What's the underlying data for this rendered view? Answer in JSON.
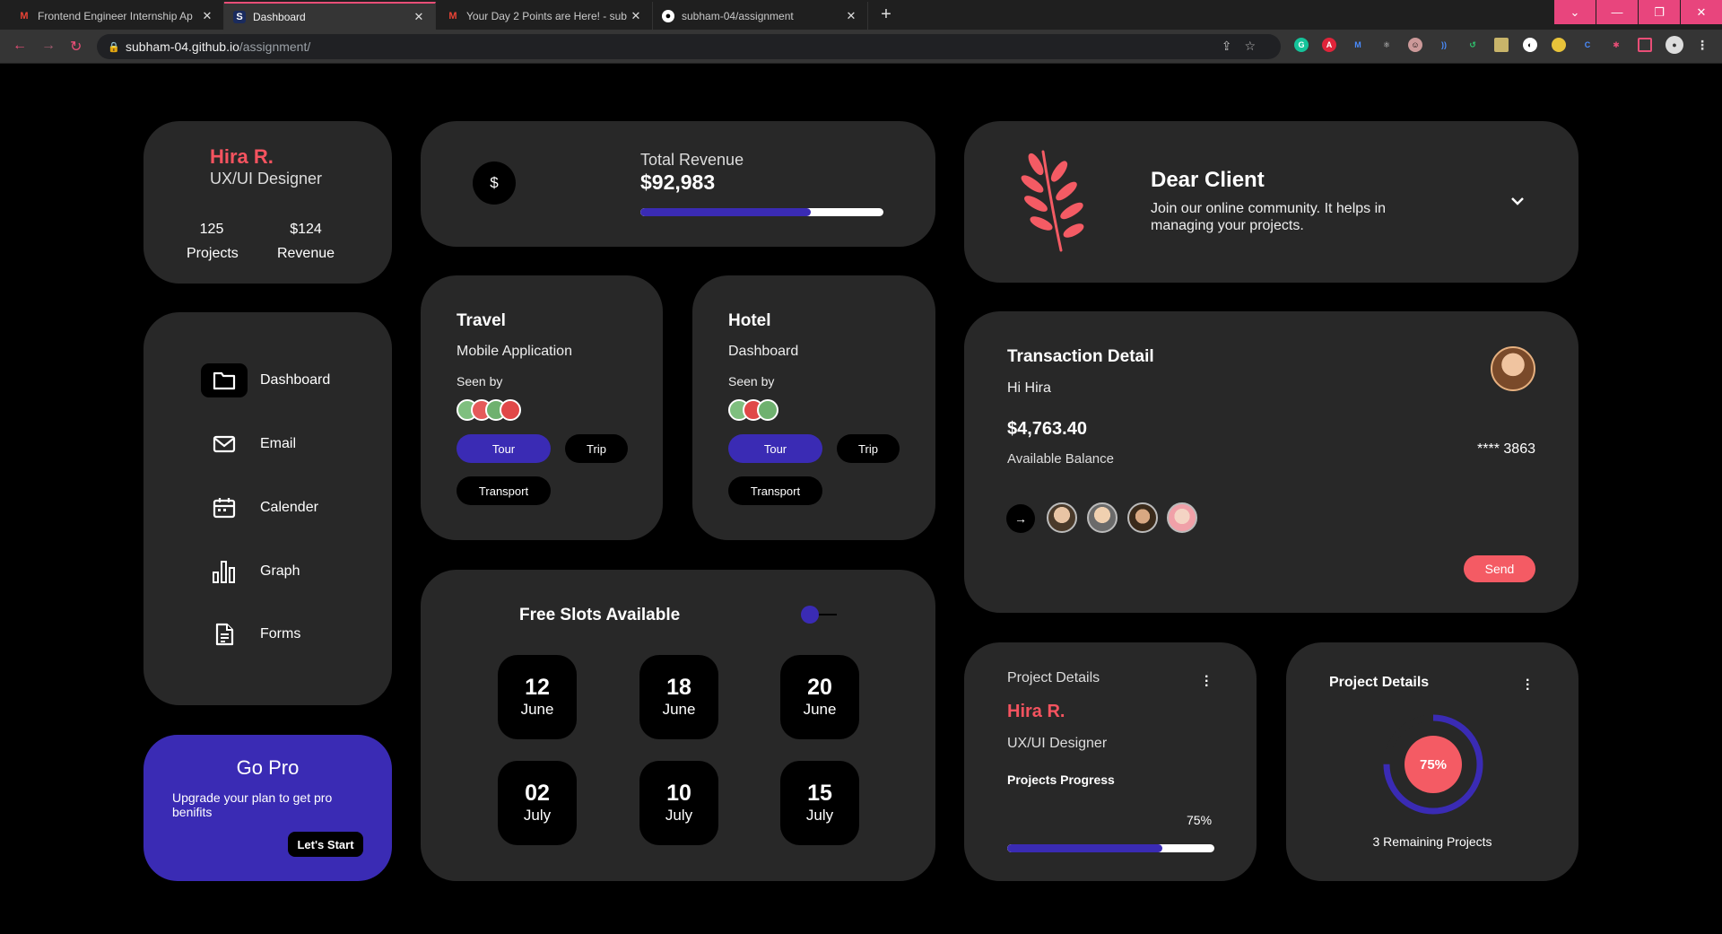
{
  "browser": {
    "tabs": [
      {
        "title": "Frontend Engineer Internship Ap",
        "icon": "gmail-icon"
      },
      {
        "title": "Dashboard",
        "icon": "site-icon",
        "active": true
      },
      {
        "title": "Your Day 2 Points are Here! - sub",
        "icon": "gmail-icon"
      },
      {
        "title": "subham-04/assignment",
        "icon": "github-icon"
      }
    ],
    "url_host": "subham-04.github.io",
    "url_path": "/assignment/",
    "accent": "#e94e77"
  },
  "profile": {
    "name": "Hira R.",
    "role": "UX/UI Designer",
    "projects_value": "125",
    "projects_label": "Projects",
    "revenue_value": "$124",
    "revenue_label": "Revenue"
  },
  "revenue": {
    "icon_text": "$",
    "label": "Total Revenue",
    "value": "$92,983",
    "progress": 0.7
  },
  "client": {
    "title": "Dear Client",
    "description": "Join our online community. It helps in managing your projects."
  },
  "sidebar": {
    "items": [
      {
        "label": "Dashboard",
        "icon": "folder-icon",
        "active": true
      },
      {
        "label": "Email",
        "icon": "mail-icon"
      },
      {
        "label": "Calender",
        "icon": "calendar-icon"
      },
      {
        "label": "Graph",
        "icon": "bar-chart-icon"
      },
      {
        "label": "Forms",
        "icon": "document-icon"
      }
    ]
  },
  "travel": {
    "title": "Travel",
    "subtitle": "Mobile Application",
    "seen_by": "Seen by",
    "tags": [
      "Tour",
      "Trip",
      "Transport"
    ]
  },
  "hotel": {
    "title": "Hotel",
    "subtitle": "Dashboard",
    "seen_by": "Seen by",
    "tags": [
      "Tour",
      "Trip",
      "Transport"
    ]
  },
  "slots": {
    "title": "Free Slots Available",
    "items": [
      {
        "day": "12",
        "month": "June",
        "selected": true
      },
      {
        "day": "18",
        "month": "June"
      },
      {
        "day": "20",
        "month": "June"
      },
      {
        "day": "02",
        "month": "July"
      },
      {
        "day": "10",
        "month": "July"
      },
      {
        "day": "15",
        "month": "July"
      }
    ]
  },
  "gopro": {
    "title": "Go Pro",
    "text": "Upgrade your plan to get pro benifits",
    "button": "Let's Start"
  },
  "transaction": {
    "title": "Transaction Detail",
    "greeting": "Hi Hira",
    "amount": "$4,763.40",
    "balance_label": "Available Balance",
    "card_number": "**** 3863",
    "send": "Send",
    "arrow": "→"
  },
  "project1": {
    "label": "Project Details",
    "name": "Hira R.",
    "role": "UX/UI Designer",
    "progress_label": "Projects Progress",
    "percent": "75%",
    "progress": 0.75
  },
  "project2": {
    "title": "Project Details",
    "percent": "75%",
    "progress": 0.75,
    "remaining": "3 Remaining Projects"
  },
  "colors": {
    "card": "#282828",
    "accent_red": "#f45b64",
    "accent_blue": "#3a2bb4"
  }
}
